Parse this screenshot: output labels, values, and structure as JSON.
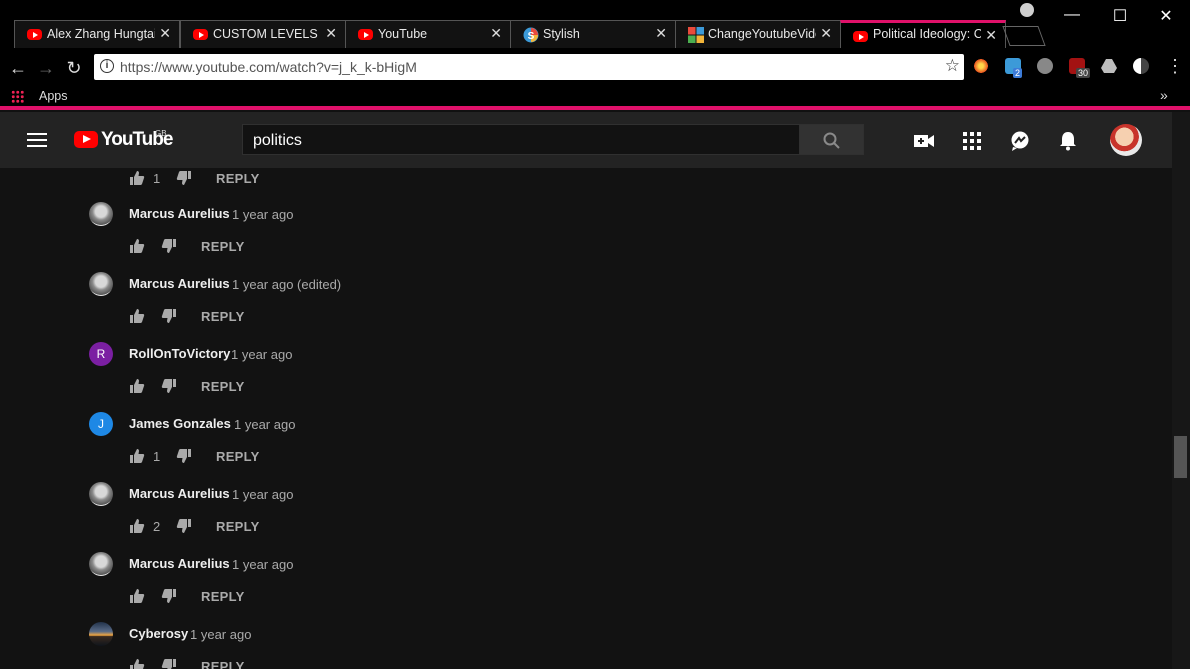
{
  "browser": {
    "tabs": [
      {
        "title": "Alex Zhang Hungtai",
        "favicon": "youtube-icon"
      },
      {
        "title": "CUSTOM LEVELS IN",
        "favicon": "youtube-icon"
      },
      {
        "title": "YouTube",
        "favicon": "youtube-icon"
      },
      {
        "title": "Stylish",
        "favicon": "stylish-icon"
      },
      {
        "title": "ChangeYoutubeVide",
        "favicon": "extension-icon"
      },
      {
        "title": "Political Ideology: C",
        "favicon": "youtube-icon",
        "active": true
      }
    ],
    "close_glyph": "✕",
    "url": "https://www.youtube.com/watch?v=j_k_k-bHigM",
    "bookmarks": {
      "apps_label": "Apps",
      "overflow": "»"
    },
    "extension_badges": {
      "stylish": "2",
      "ublock": "30"
    },
    "accent_color": "#e0116a"
  },
  "youtube": {
    "logo_text": "YouTube",
    "region": "GB",
    "search_query": "politics"
  },
  "comments": [
    {
      "author": "Marcus Aurelius",
      "time": "1 year ago",
      "likes": "",
      "reply": "REPLY",
      "avatar": "statue"
    },
    {
      "author": "Marcus Aurelius",
      "time": "1 year ago (edited)",
      "likes": "",
      "reply": "REPLY",
      "avatar": "statue"
    },
    {
      "author": "RollOnToVictory",
      "time": "1 year ago",
      "likes": "",
      "reply": "REPLY",
      "avatar": "letter",
      "initial": "R",
      "avatar_color": "#7b1fa2"
    },
    {
      "author": "James Gonzales",
      "time": "1 year ago",
      "likes": "1",
      "reply": "REPLY",
      "avatar": "letter",
      "initial": "J",
      "avatar_color": "#1e88e5"
    },
    {
      "author": "Marcus Aurelius",
      "time": "1 year ago",
      "likes": "2",
      "reply": "REPLY",
      "avatar": "statue"
    },
    {
      "author": "Marcus Aurelius",
      "time": "1 year ago",
      "likes": "",
      "reply": "REPLY",
      "avatar": "statue"
    },
    {
      "author": "Cyberosy",
      "time": "1 year ago",
      "likes": "",
      "reply": "REPLY",
      "avatar": "sunset"
    }
  ],
  "partial_top_comment": {
    "likes": "1",
    "reply": "REPLY"
  }
}
